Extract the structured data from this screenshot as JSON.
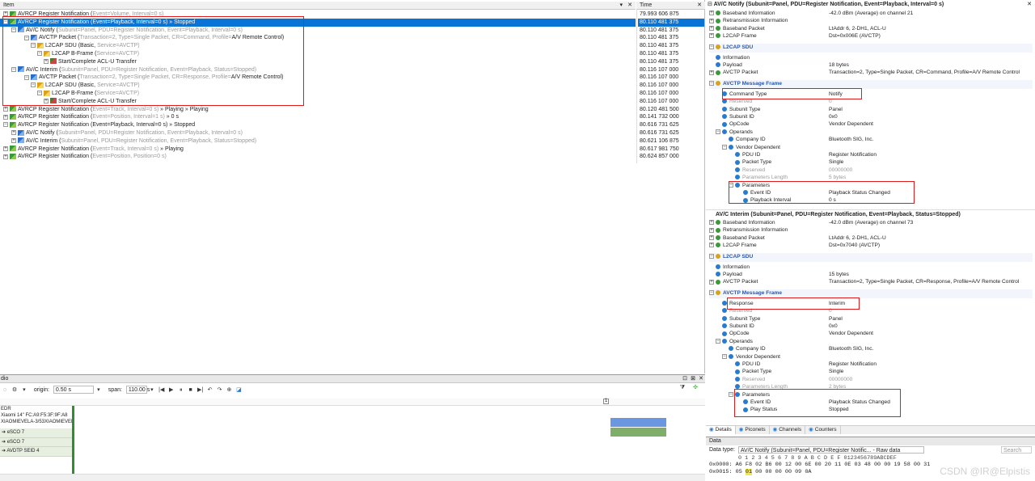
{
  "packet_list": {
    "col_item": "Item",
    "col_time": "Time",
    "rows": [
      {
        "pre": "AVRCP Register Notification (",
        "dim": "Event=Volume, Interval=0 s)",
        "post": "",
        "time": "79.993 606 875"
      },
      {
        "pre": "AVRCP Register Notification (Event=Playback, Interval=0 s) » Stopped",
        "dim": "",
        "post": "",
        "time": "80.110 481 375"
      },
      {
        "pre": "AV/C Notify (",
        "dim": "Subunit=Panel, PDU=Register Notification, Event=Playback, Interval=0 s)",
        "post": "",
        "time": "80.110 481 375"
      },
      {
        "pre": "AVCTP Packet (",
        "dim": "Transaction=2, Type=Single Packet, CR=Command, Profile=",
        "post": "A/V Remote Control)",
        "time": "80.110 481 375"
      },
      {
        "pre": "L2CAP SDU (Basic, ",
        "dim": "Service=AVCTP)",
        "post": "",
        "time": "80.110 481 375"
      },
      {
        "pre": "L2CAP B-Frame (",
        "dim": "Service=AVCTP)",
        "post": "",
        "time": "80.110 481 375"
      },
      {
        "pre": "Start/Complete ACL-U Transfer",
        "dim": "",
        "post": "",
        "time": "80.110 481 375"
      },
      {
        "pre": "AV/C Interim (",
        "dim": "Subunit=Panel, PDU=Register Notification, Event=Playback, Status=Stopped)",
        "post": "",
        "time": "80.116 107 000"
      },
      {
        "pre": "AVCTP Packet (",
        "dim": "Transaction=2, Type=Single Packet, CR=Response, Profile=",
        "post": "A/V Remote Control)",
        "time": "80.116 107 000"
      },
      {
        "pre": "L2CAP SDU (Basic, ",
        "dim": "Service=AVCTP)",
        "post": "",
        "time": "80.116 107 000"
      },
      {
        "pre": "L2CAP B-Frame (",
        "dim": "Service=AVCTP)",
        "post": "",
        "time": "80.116 107 000"
      },
      {
        "pre": "Start/Complete ACL-U Transfer",
        "dim": "",
        "post": "",
        "time": "80.116 107 000"
      },
      {
        "pre": "AVRCP Register Notification (",
        "dim": "Event=Track, Interval=0 s)",
        "post": " » Playing » Playing",
        "time": "80.120 481 500"
      },
      {
        "pre": "AVRCP Register Notification (",
        "dim": "Event=Position, Interval=1 s)",
        "post": " » 0 s",
        "time": "80.141 732 000"
      },
      {
        "pre": "AVRCP Register Notification (Event=Playback, Interval=0 s) » Stopped",
        "dim": "",
        "post": "",
        "time": "80.616 731 625"
      },
      {
        "pre": "AV/C Notify (",
        "dim": "Subunit=Panel, PDU=Register Notification, Event=Playback, Interval=0 s)",
        "post": "",
        "time": "80.616 731 625"
      },
      {
        "pre": "AV/C Interim (",
        "dim": "Subunit=Panel, PDU=Register Notification, Event=Playback, Status=Stopped)",
        "post": "",
        "time": "80.621 106 875"
      },
      {
        "pre": "AVRCP Register Notification (",
        "dim": "Event=Track, Interval=0 s)",
        "post": " » Playing",
        "time": "80.617 981 750"
      },
      {
        "pre": "AVRCP Register Notification (",
        "dim": "Event=Position, Position=0 s)",
        "post": "",
        "time": "80.624 857 000"
      }
    ]
  },
  "details_top": {
    "title": "AV/C Notify (Subunit=Panel, PDU=Register Notification, Event=Playback, Interval=0 s)",
    "rows": [
      {
        "l": "Baseband Information",
        "v": "-42.0 dBm (Average) on channel 21"
      },
      {
        "l": "Retransmission Information",
        "v": ""
      },
      {
        "l": "Baseband Packet",
        "v": "LtAddr 6, 2-DH1, ACL-U"
      },
      {
        "l": "L2CAP Frame",
        "v": "Dst=0x006E (AVCTP)"
      },
      {
        "l": "L2CAP SDU",
        "v": ""
      },
      {
        "l": "Information",
        "v": ""
      },
      {
        "l": "Payload",
        "v": "18 bytes"
      },
      {
        "l": "AVCTP Packet",
        "v": "Transaction=2, Type=Single Packet, CR=Command, Profile=A/V Remote Control"
      },
      {
        "l": "AVCTP Message Frame",
        "v": ""
      },
      {
        "l": "Command Type",
        "v": "Notify"
      },
      {
        "l": "Reserved",
        "v": "0"
      },
      {
        "l": "Subunit Type",
        "v": "Panel"
      },
      {
        "l": "Subunit ID",
        "v": "0x0"
      },
      {
        "l": "OpCode",
        "v": "Vendor Dependent"
      },
      {
        "l": "Operands",
        "v": ""
      },
      {
        "l": "Company ID",
        "v": "Bluetooth SIG, Inc."
      },
      {
        "l": "Vendor Dependent",
        "v": ""
      },
      {
        "l": "PDU ID",
        "v": "Register Notification"
      },
      {
        "l": "Packet Type",
        "v": "Single"
      },
      {
        "l": "Reserved",
        "v": "00000000"
      },
      {
        "l": "Parameters Length",
        "v": "5 bytes"
      },
      {
        "l": "Parameters",
        "v": ""
      },
      {
        "l": "Event ID",
        "v": "Playback Status Changed"
      },
      {
        "l": "Playback Interval",
        "v": "0 s"
      }
    ]
  },
  "details_bottom": {
    "title": "AV/C Interim (Subunit=Panel, PDU=Register Notification, Event=Playback, Status=Stopped)",
    "rows": [
      {
        "l": "Baseband Information",
        "v": "-42.0 dBm (Average) on channel 73"
      },
      {
        "l": "Retransmission Information",
        "v": ""
      },
      {
        "l": "Baseband Packet",
        "v": "LtAddr 6, 2-DH1, ACL-U"
      },
      {
        "l": "L2CAP Frame",
        "v": "Dst=0x7040 (AVCTP)"
      },
      {
        "l": "L2CAP SDU",
        "v": ""
      },
      {
        "l": "Information",
        "v": ""
      },
      {
        "l": "Payload",
        "v": "15 bytes"
      },
      {
        "l": "AVCTP Packet",
        "v": "Transaction=2, Type=Single Packet, CR=Response, Profile=A/V Remote Control"
      },
      {
        "l": "AVCTP Message Frame",
        "v": ""
      },
      {
        "l": "Response",
        "v": "Interim"
      },
      {
        "l": "Reserved",
        "v": "0"
      },
      {
        "l": "Subunit Type",
        "v": "Panel"
      },
      {
        "l": "Subunit ID",
        "v": "0x0"
      },
      {
        "l": "OpCode",
        "v": "Vendor Dependent"
      },
      {
        "l": "Operands",
        "v": ""
      },
      {
        "l": "Company ID",
        "v": "Bluetooth SIG, Inc."
      },
      {
        "l": "Vendor Dependent",
        "v": ""
      },
      {
        "l": "PDU ID",
        "v": "Register Notification"
      },
      {
        "l": "Packet Type",
        "v": "Single"
      },
      {
        "l": "Reserved",
        "v": "00000000"
      },
      {
        "l": "Parameters Length",
        "v": "2 bytes"
      },
      {
        "l": "Parameters",
        "v": ""
      },
      {
        "l": "Event ID",
        "v": "Playback Status Changed"
      },
      {
        "l": "Play Status",
        "v": "Stopped"
      }
    ]
  },
  "details_tabs": [
    "Details",
    "Piconets",
    "Channels",
    "Counters"
  ],
  "data_panel": {
    "header": "Data",
    "type_label": "Data type:",
    "type_value": "AV/C Notify (Subunit=Panel, PDU=Register Notific... - Raw data",
    "search_placeholder": "Search",
    "col_header": "0  1  2  3  4  5  6  7  8  9  A  B  C  D  E  F  0123456789ABCDEF",
    "line1_addr": "0x0000:",
    "line1_hex": "A6 F8 02 B6 00 12 00 6E 00 20 11 0E 03 48 00 00 19 58 00 31",
    "line2_addr": "0x0015:",
    "line2_hex_pre": "05 ",
    "line2_hex_hl": "01",
    "line2_hex_post": " 00 00 00 00 09 0A"
  },
  "timeline": {
    "label": "dio",
    "origin_label": "origin:",
    "origin_value": "0.50 s",
    "span_label": "span:",
    "span_value": "110.00 s",
    "device_header": "EDR",
    "device_name": "Xiaomi 14\" FC:A9:F5:3F:9F:A8",
    "device_sub": "XIAOMIEVELA-3/53XIAOMIEVELA-03\"6...",
    "lanes": [
      "eSCO 7",
      "eSCO 7",
      "AVDTP SEID 4"
    ]
  },
  "watermark": "CSDN @IR@Elpistis"
}
